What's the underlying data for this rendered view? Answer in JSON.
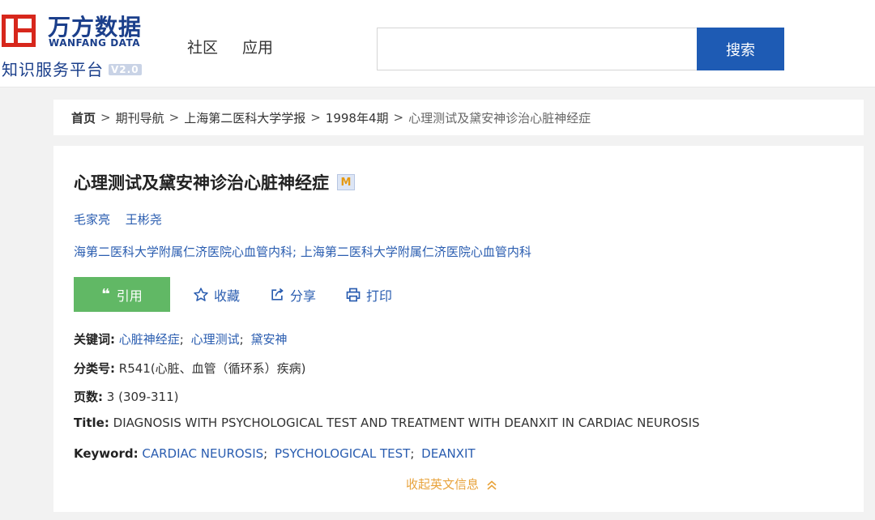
{
  "header": {
    "logo": {
      "cn": "万方数据",
      "en": "WANFANG DATA",
      "subtitle": "知识服务平台",
      "version": "V2.0"
    },
    "nav": [
      "社区",
      "应用"
    ],
    "search": {
      "value": "",
      "placeholder": "",
      "button": "搜索"
    }
  },
  "breadcrumb": {
    "items": [
      "首页",
      "期刊导航",
      "上海第二医科大学学报",
      "1998年4期"
    ],
    "current": "心理测试及黛安神诊治心脏神经症",
    "separator": ">"
  },
  "article": {
    "title": "心理测试及黛安神诊治心脏神经症",
    "badge": "M",
    "authors": [
      "毛家亮",
      "王彬尧"
    ],
    "affiliations": [
      "海第二医科大学附属仁济医院心血管内科",
      "上海第二医科大学附属仁济医院心血管内科"
    ],
    "actions": {
      "cite": "引用",
      "favorite": "收藏",
      "share": "分享",
      "print": "打印"
    },
    "keywords_label": "关键词:",
    "keywords": [
      "心脏神经症",
      "心理测试",
      "黛安神"
    ],
    "classification_label": "分类号:",
    "classification": "R541(心脏、血管（循环系）疾病)",
    "pages_label": "页数:",
    "pages": "3 (309-311)",
    "title_en_label": "Title:",
    "title_en": "DIAGNOSIS WITH PSYCHOLOGICAL TEST AND TREATMENT WITH DEANXIT IN CARDIAC NEUROSIS",
    "keyword_en_label": "Keyword:",
    "keywords_en": [
      "CARDIAC NEUROSIS",
      "PSYCHOLOGICAL TEST",
      "DEANXIT"
    ],
    "collapse": "收起英文信息"
  },
  "colors": {
    "brand_blue": "#1b3f8b",
    "logo_red": "#d7271c",
    "search_button": "#1e5bb4",
    "link": "#2a5db0",
    "cite_green": "#61b865",
    "collapse_orange": "#e8a33c"
  }
}
